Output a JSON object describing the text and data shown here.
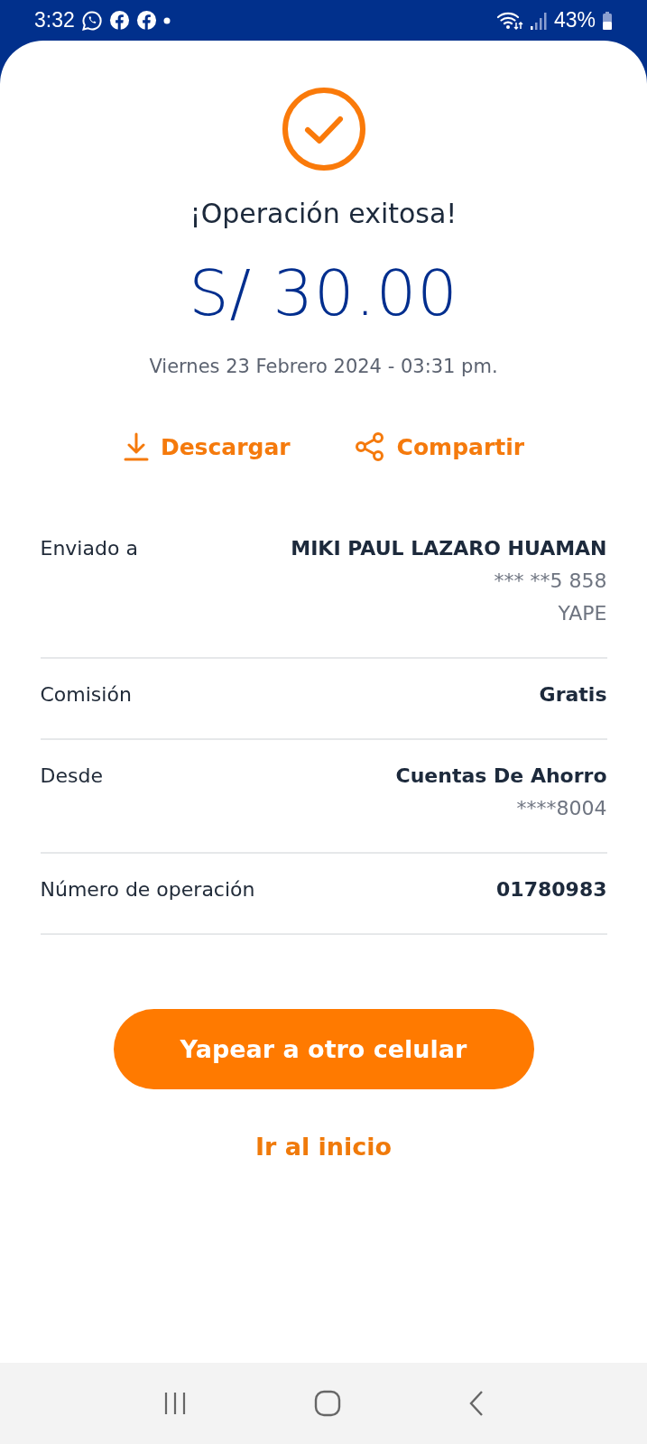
{
  "status_bar": {
    "time": "3:32",
    "battery": "43%"
  },
  "title": "¡Operación exitosa!",
  "amount": "S/ 30.00",
  "date": "Viernes 23 Febrero 2024 - 03:31 pm.",
  "actions": [
    {
      "kind": "download",
      "label": "Descargar"
    },
    {
      "kind": "share",
      "label": "Compartir"
    }
  ],
  "details": [
    {
      "label": "Enviado a",
      "lines": [
        {
          "text": "MIKI PAUL LAZARO HUAMAN",
          "kind": "strong"
        },
        {
          "text": "*** **5 858",
          "kind": "muted"
        },
        {
          "text": "YAPE",
          "kind": "muted"
        }
      ]
    },
    {
      "label": "Comisión",
      "lines": [
        {
          "text": "Gratis",
          "kind": "strong"
        }
      ]
    },
    {
      "label": "Desde",
      "lines": [
        {
          "text": "Cuentas De Ahorro",
          "kind": "strong"
        },
        {
          "text": "****8004",
          "kind": "muted"
        }
      ]
    },
    {
      "label": "Número de operación",
      "lines": [
        {
          "text": "01780983",
          "kind": "strong"
        }
      ]
    }
  ],
  "primary_button": "Yapear a otro celular",
  "secondary_link": "Ir al inicio"
}
